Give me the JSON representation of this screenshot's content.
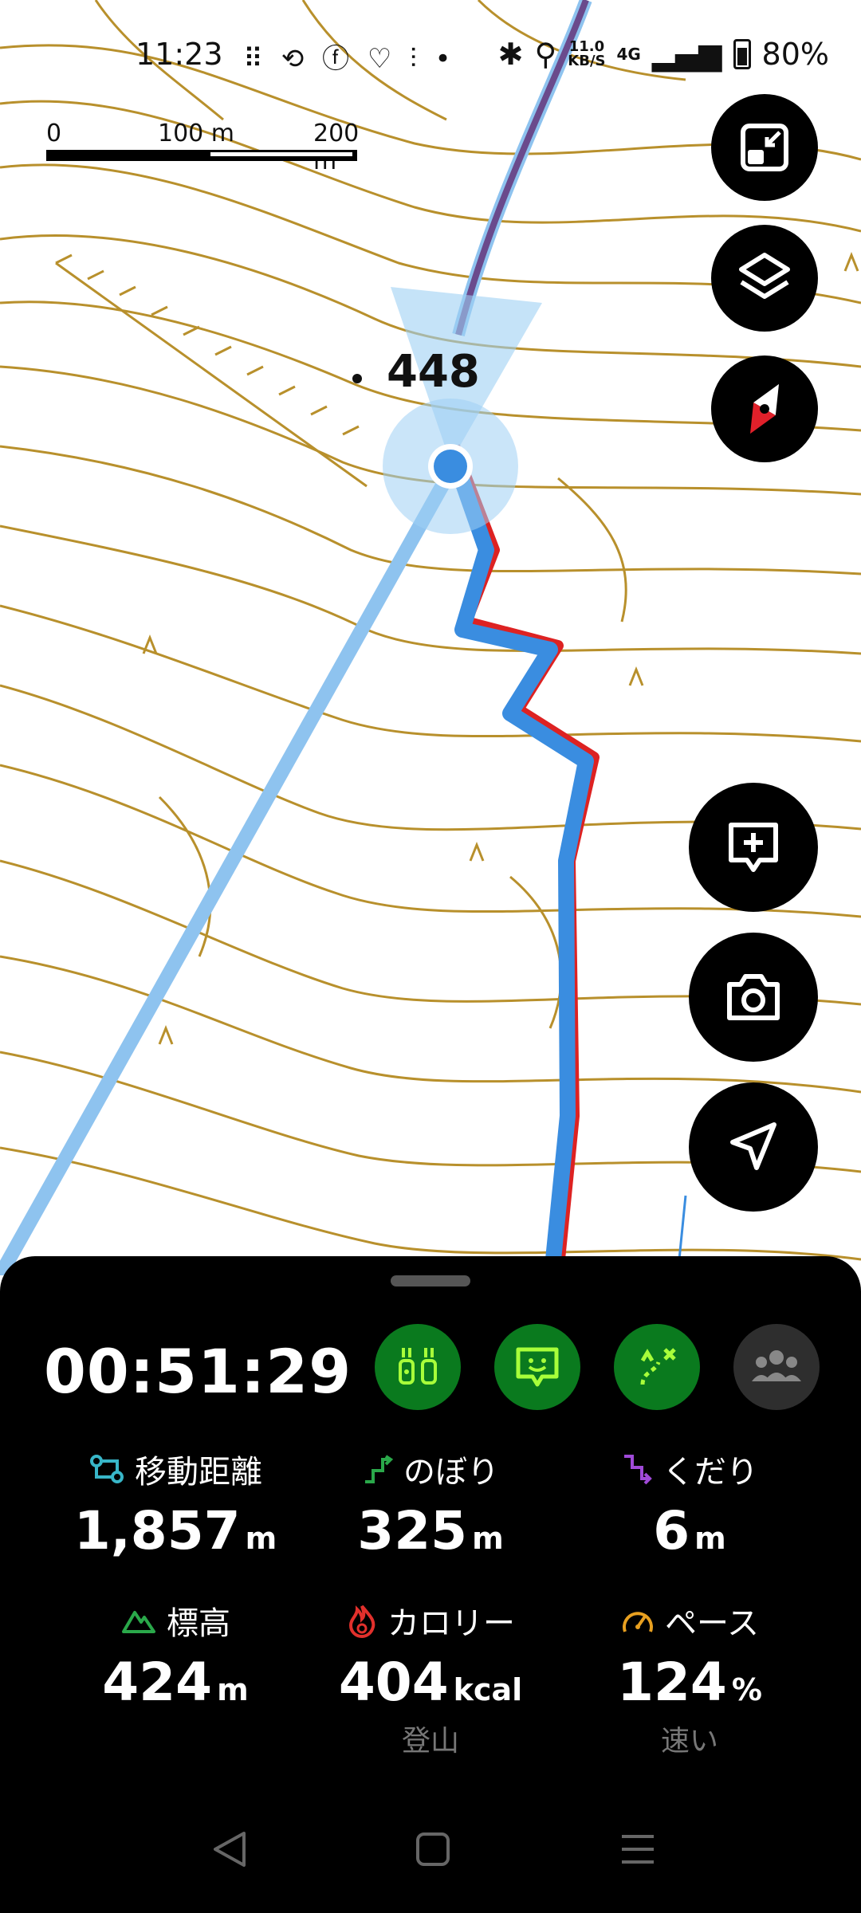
{
  "status_bar": {
    "time": "11:23",
    "notif_icons": [
      "step-icon",
      "refresh-icon",
      "facebook-icon",
      "heart-icon",
      "bars-icon",
      "dot-icon"
    ],
    "net_speed": "11.0",
    "net_unit": "KB/S",
    "network": "4G",
    "battery": "80%"
  },
  "scale": {
    "label_0": "0",
    "label_100": "100 m",
    "label_200": "200 m"
  },
  "map": {
    "elevation_label": "448"
  },
  "tracker": {
    "elapsed": "00:51:29",
    "mode_icons": [
      "gear-icon",
      "speech-icon",
      "route-icon",
      "group-icon"
    ],
    "stats": [
      {
        "label": "移動距離",
        "value": "1,857",
        "unit": "m",
        "icon": "distance-icon"
      },
      {
        "label": "のぼり",
        "value": "325",
        "unit": "m",
        "icon": "ascent-icon"
      },
      {
        "label": "くだり",
        "value": "6",
        "unit": "m",
        "icon": "descent-icon"
      },
      {
        "label": "標高",
        "value": "424",
        "unit": "m",
        "icon": "mountain-icon"
      },
      {
        "label": "カロリー",
        "value": "404",
        "unit": "kcal",
        "sub": "登山",
        "icon": "flame-icon"
      },
      {
        "label": "ペース",
        "value": "124",
        "unit": "%",
        "sub": "速い",
        "icon": "speedometer-icon"
      }
    ]
  },
  "colors": {
    "track": "#3a8de0",
    "route": "#6a4a8c",
    "contour": "#b8902c",
    "accent_green": "#0a7a1e"
  }
}
